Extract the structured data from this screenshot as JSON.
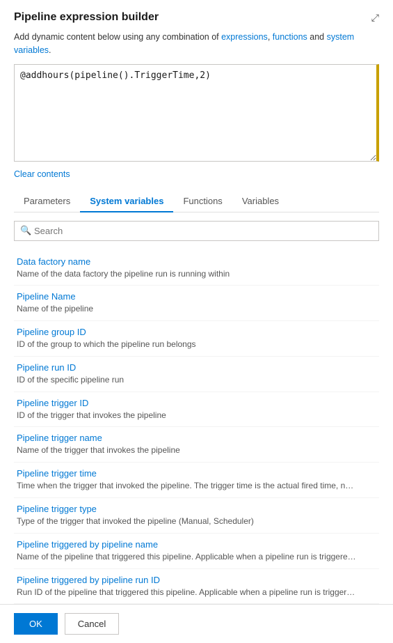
{
  "header": {
    "title": "Pipeline expression builder",
    "expand_icon": "⤢"
  },
  "description": {
    "text_before": "Add dynamic content below using any combination of ",
    "link1": "expressions",
    "text_between1": ", ",
    "link2": "functions",
    "text_between2": " and ",
    "link3": "system variables",
    "text_after": "."
  },
  "expression": {
    "value": "@addhours(pipeline().TriggerTime,2)"
  },
  "clear_contents": "Clear contents",
  "tabs": [
    {
      "label": "Parameters",
      "active": false
    },
    {
      "label": "System variables",
      "active": true
    },
    {
      "label": "Functions",
      "active": false
    },
    {
      "label": "Variables",
      "active": false
    }
  ],
  "search": {
    "placeholder": "Search"
  },
  "variables": [
    {
      "name": "Data factory name",
      "desc": "Name of the data factory the pipeline run is running within"
    },
    {
      "name": "Pipeline Name",
      "desc": "Name of the pipeline"
    },
    {
      "name": "Pipeline group ID",
      "desc": "ID of the group to which the pipeline run belongs"
    },
    {
      "name": "Pipeline run ID",
      "desc": "ID of the specific pipeline run"
    },
    {
      "name": "Pipeline trigger ID",
      "desc": "ID of the trigger that invokes the pipeline"
    },
    {
      "name": "Pipeline trigger name",
      "desc": "Name of the trigger that invokes the pipeline"
    },
    {
      "name": "Pipeline trigger time",
      "desc": "Time when the trigger that invoked the pipeline. The trigger time is the actual fired time, not the sched..."
    },
    {
      "name": "Pipeline trigger type",
      "desc": "Type of the trigger that invoked the pipeline (Manual, Scheduler)"
    },
    {
      "name": "Pipeline triggered by pipeline name",
      "desc": "Name of the pipeline that triggered this pipeline. Applicable when a pipeline run is triggered by an Exe..."
    },
    {
      "name": "Pipeline triggered by pipeline run ID",
      "desc": "Run ID of the pipeline that triggered this pipeline. Applicable when a pipeline run is triggered by an Ex..."
    }
  ],
  "footer": {
    "ok_label": "OK",
    "cancel_label": "Cancel"
  }
}
